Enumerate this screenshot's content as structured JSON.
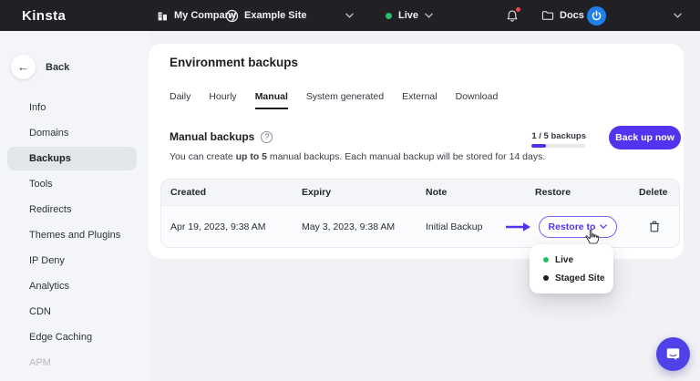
{
  "topbar": {
    "logo": "Kinsta",
    "company": "My Company",
    "site": "Example Site",
    "environment": "Live",
    "docs_label": "Docs"
  },
  "sidebar": {
    "back_label": "Back",
    "items": [
      {
        "label": "Info",
        "selected": false
      },
      {
        "label": "Domains",
        "selected": false
      },
      {
        "label": "Backups",
        "selected": true
      },
      {
        "label": "Tools",
        "selected": false
      },
      {
        "label": "Redirects",
        "selected": false
      },
      {
        "label": "Themes and Plugins",
        "selected": false
      },
      {
        "label": "IP Deny",
        "selected": false
      },
      {
        "label": "Analytics",
        "selected": false
      },
      {
        "label": "CDN",
        "selected": false
      },
      {
        "label": "Edge Caching",
        "selected": false
      },
      {
        "label": "APM",
        "selected": false
      }
    ]
  },
  "main": {
    "title": "Environment backups",
    "tabs": [
      {
        "label": "Daily"
      },
      {
        "label": "Hourly"
      },
      {
        "label": "Manual"
      },
      {
        "label": "System generated"
      },
      {
        "label": "External"
      },
      {
        "label": "Download"
      }
    ],
    "active_tab": "Manual",
    "manual_section": {
      "heading": "Manual backups",
      "help_glyph": "?",
      "usage_label": "1 / 5 backups",
      "usage_percent": 20,
      "backup_button_label": "Back up now",
      "description": {
        "prefix": "You can create ",
        "bold": "up to 5",
        "suffix": " manual backups. Each manual backup will be stored for 14 days."
      }
    },
    "table": {
      "columns": [
        {
          "label": "Created"
        },
        {
          "label": "Expiry"
        },
        {
          "label": "Note"
        },
        {
          "label": "Restore"
        },
        {
          "label": "Delete"
        }
      ],
      "rows": [
        {
          "created": "Apr 19, 2023, 9:38 AM",
          "expiry": "May 3, 2023, 9:38 AM",
          "note": "Initial Backup",
          "restore_label": "Restore to"
        }
      ]
    },
    "restore_dropdown": {
      "items": [
        {
          "label": "Live",
          "dot_color": "#23c16b"
        },
        {
          "label": "Staged Site",
          "dot_color": "#1d1e20"
        }
      ]
    }
  },
  "colors": {
    "brand_purple": "#5333ed",
    "topbar_bg": "#212125",
    "live_green": "#23c16b",
    "notification_red": "#e5484d",
    "avatar_blue": "#1e80e8"
  }
}
